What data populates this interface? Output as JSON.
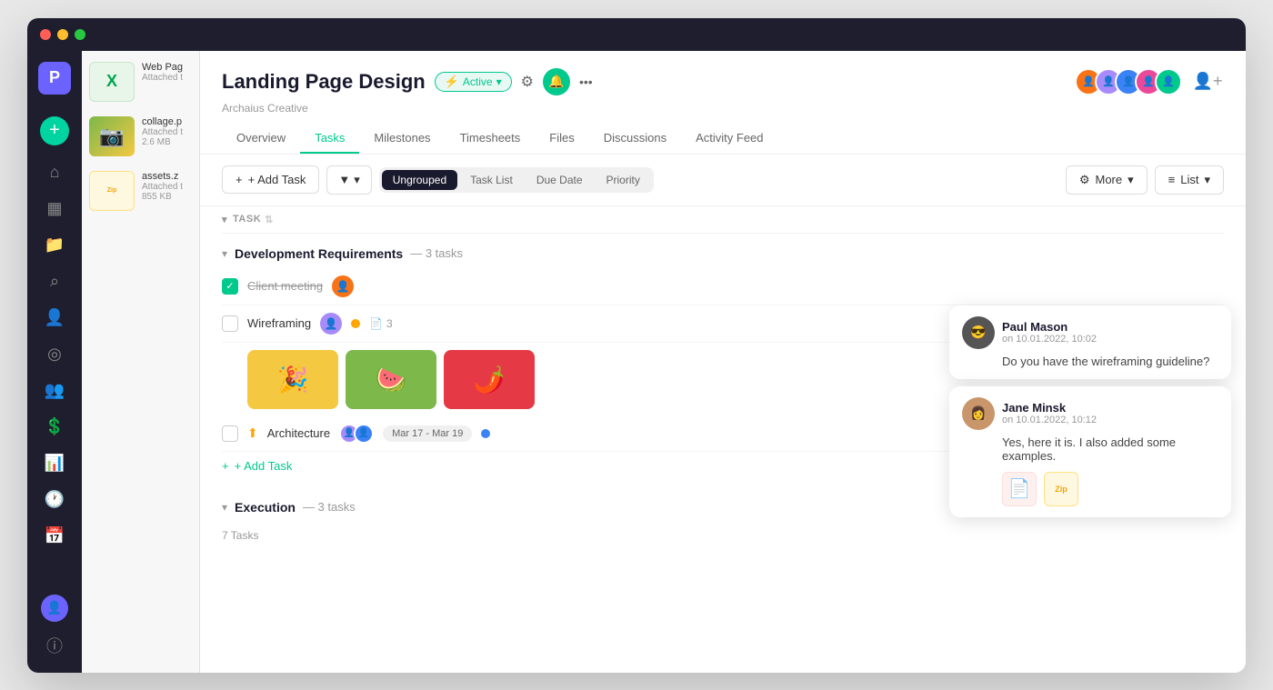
{
  "window": {
    "title": "Landing Page Design"
  },
  "sidebar": {
    "logo": "P",
    "icons": [
      {
        "name": "home-icon",
        "symbol": "⌂",
        "active": false
      },
      {
        "name": "grid-icon",
        "symbol": "▦",
        "active": false
      },
      {
        "name": "folder-icon",
        "symbol": "📁",
        "active": true
      },
      {
        "name": "search-icon",
        "symbol": "⌕",
        "active": false
      },
      {
        "name": "person-icon",
        "symbol": "👤",
        "active": false
      },
      {
        "name": "eye-icon",
        "symbol": "◎",
        "active": false
      },
      {
        "name": "team-icon",
        "symbol": "👥",
        "active": false
      },
      {
        "name": "dollar-icon",
        "symbol": "＄",
        "active": false
      },
      {
        "name": "chart-icon",
        "symbol": "📊",
        "active": false
      },
      {
        "name": "clock-icon",
        "symbol": "🕐",
        "active": false
      },
      {
        "name": "calendar-icon",
        "symbol": "📅",
        "active": false
      }
    ]
  },
  "files_panel": {
    "items": [
      {
        "name": "web_pa",
        "full_name": "Web Pag",
        "meta": "Attached t",
        "type": "excel",
        "icon": "X",
        "color": "#00a651",
        "has_thumb": false
      },
      {
        "name": "collage",
        "full_name": "collage.p",
        "meta": "Attached t",
        "size": "2.6 MB",
        "type": "image",
        "has_thumb": true
      },
      {
        "name": "assets",
        "full_name": "assets.z",
        "meta": "Attached t",
        "size": "855 KB",
        "type": "zip",
        "icon": "Zip",
        "color": "#f0a500",
        "has_thumb": false
      }
    ]
  },
  "project": {
    "title": "Landing Page Design",
    "subtitle": "Archaius Creative",
    "status": "Active",
    "status_color": "#00c98d"
  },
  "tabs": [
    {
      "label": "Overview",
      "active": false
    },
    {
      "label": "Tasks",
      "active": true
    },
    {
      "label": "Milestones",
      "active": false
    },
    {
      "label": "Timesheets",
      "active": false
    },
    {
      "label": "Files",
      "active": false
    },
    {
      "label": "Discussions",
      "active": false
    },
    {
      "label": "Activity Feed",
      "active": false
    }
  ],
  "toolbar": {
    "add_task_label": "+ Add Task",
    "grouping": {
      "ungrouped": "Ungrouped",
      "task_list": "Task List",
      "due_date": "Due Date",
      "priority": "Priority"
    },
    "more_label": "More",
    "list_label": "List"
  },
  "task_column_header": "TASK",
  "sections": [
    {
      "name": "development_requirements",
      "title": "Development Requirements",
      "count_text": "— 3 tasks",
      "tasks": [
        {
          "id": "t1",
          "name": "Client meeting",
          "checked": true,
          "done": true,
          "has_avatar": true,
          "avatar_color": "#f97316"
        },
        {
          "id": "t2",
          "name": "Wireframing",
          "checked": false,
          "done": false,
          "has_avatar": true,
          "avatar_color": "#a78bfa",
          "dot_color": "#ffa500",
          "file_count": "3",
          "has_attachments": true,
          "attachments": [
            {
              "type": "yellow",
              "emoji": "🎉"
            },
            {
              "type": "green",
              "emoji": "🍉"
            },
            {
              "type": "red",
              "emoji": "🌶️"
            }
          ]
        },
        {
          "id": "t3",
          "name": "Architecture",
          "checked": false,
          "done": false,
          "has_priority": true,
          "avatars": [
            "#a78bfa",
            "#3b82f6"
          ],
          "date": "Mar 17 - Mar 19",
          "dot_color": "#3b82f6"
        }
      ],
      "add_task_label": "+ Add Task"
    },
    {
      "name": "execution",
      "title": "Execution",
      "count_text": "— 3 tasks",
      "tasks": []
    }
  ],
  "total_tasks_label": "7 Tasks",
  "comments": [
    {
      "id": "c1",
      "author": "Paul Mason",
      "time": "on 10.01.2022, 10:02",
      "text": "Do you have the wireframing guideline?",
      "avatar_color": "#333",
      "files": []
    },
    {
      "id": "c2",
      "author": "Jane Minsk",
      "time": "on 10.01.2022, 10:12",
      "text": "Yes, here it is. I also added some examples.",
      "avatar_color": "#7c5c3a",
      "files": [
        {
          "type": "pdf",
          "icon": "📄",
          "color": "#e63946"
        },
        {
          "type": "zip",
          "icon": "Zip",
          "color": "#f0a500"
        }
      ]
    }
  ],
  "header_avatars": [
    "#f97316",
    "#a78bfa",
    "#3b82f6",
    "#ec4899",
    "#00c98d"
  ]
}
